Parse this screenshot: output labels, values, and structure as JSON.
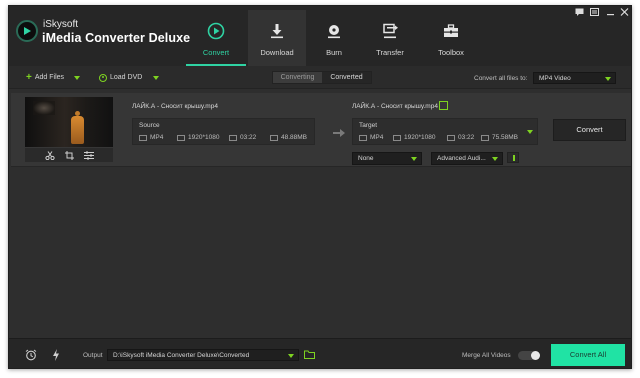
{
  "app": {
    "brand_top": "iSkysoft",
    "brand_main": "iMedia Converter Deluxe"
  },
  "nav": {
    "tabs": [
      {
        "label": "Convert",
        "icon": "convert-icon",
        "active": true
      },
      {
        "label": "Download",
        "icon": "download-icon",
        "active": false
      },
      {
        "label": "Burn",
        "icon": "burn-icon",
        "active": false
      },
      {
        "label": "Transfer",
        "icon": "transfer-icon",
        "active": false
      },
      {
        "label": "Toolbox",
        "icon": "toolbox-icon",
        "active": false
      }
    ]
  },
  "toolbar": {
    "add_files": "Add Files",
    "load_dvd": "Load DVD",
    "seg_converting": "Converting",
    "seg_converted": "Converted",
    "convert_all_label": "Convert all files to:",
    "convert_all_value": "MP4 Video"
  },
  "file": {
    "source_name": "ЛАЙК.А - Сносит крышу.mp4",
    "target_name": "ЛАЙК.А - Сносит крышу.mp4",
    "source": {
      "title": "Source",
      "format": "MP4",
      "resolution": "1920*1080",
      "duration": "03:22",
      "size": "48.88MB"
    },
    "target": {
      "title": "Target",
      "format": "MP4",
      "resolution": "1920*1080",
      "duration": "03:22",
      "size": "75.58MB"
    },
    "subtitle_value": "None",
    "audio_value": "Advanced Audi...",
    "convert_label": "Convert"
  },
  "bottom": {
    "output_label": "Output",
    "output_path": "D:\\iSkysoft iMedia Converter Deluxe\\Converted",
    "merge_label": "Merge All Videos",
    "merge_on": false,
    "convert_all_label": "Convert All"
  },
  "colors": {
    "accent": "#2fd3a3",
    "green_icon": "#7ed321",
    "convert_all_bg": "#20e3a4",
    "header_bg": "#262626",
    "body_bg": "#2e2e2e"
  }
}
